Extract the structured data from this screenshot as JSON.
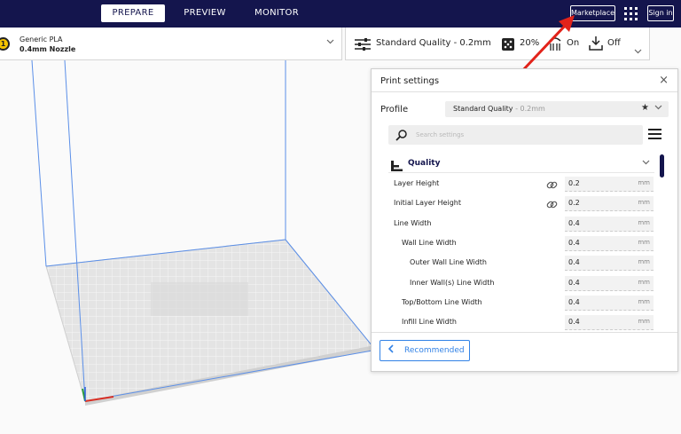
{
  "topbar": {
    "tabs": [
      {
        "label": "PREPARE",
        "active": true
      },
      {
        "label": "PREVIEW",
        "active": false
      },
      {
        "label": "MONITOR",
        "active": false
      }
    ],
    "marketplace_label": "Marketplace",
    "signin_label": "Sign in"
  },
  "printer": {
    "extruder_number": "1",
    "material": "Generic PLA",
    "nozzle": "0.4mm Nozzle"
  },
  "quality_bar": {
    "profile": "Standard Quality - 0.2mm",
    "infill": "20%",
    "support": "On",
    "adhesion": "Off"
  },
  "print_settings": {
    "title": "Print settings",
    "close_glyph": "×",
    "profile_label": "Profile",
    "profile_name": "Standard Quality",
    "profile_sub": " - 0.2mm",
    "search_placeholder": "Search settings",
    "category": "Quality",
    "rows": [
      {
        "label": "Layer Height",
        "value": "0.2",
        "unit": "mm",
        "linked": true,
        "indent": 0
      },
      {
        "label": "Initial Layer Height",
        "value": "0.2",
        "unit": "mm",
        "linked": true,
        "indent": 0
      },
      {
        "label": "Line Width",
        "value": "0.4",
        "unit": "mm",
        "linked": false,
        "indent": 0
      },
      {
        "label": "Wall Line Width",
        "value": "0.4",
        "unit": "mm",
        "linked": false,
        "indent": 1
      },
      {
        "label": "Outer Wall Line Width",
        "value": "0.4",
        "unit": "mm",
        "linked": false,
        "indent": 2
      },
      {
        "label": "Inner Wall(s) Line Width",
        "value": "0.4",
        "unit": "mm",
        "linked": false,
        "indent": 2
      },
      {
        "label": "Top/Bottom Line Width",
        "value": "0.4",
        "unit": "mm",
        "linked": false,
        "indent": 1
      },
      {
        "label": "Infill Line Width",
        "value": "0.4",
        "unit": "mm",
        "linked": false,
        "indent": 1
      }
    ],
    "recommended_label": "Recommended"
  },
  "colors": {
    "topbar": "#14154d",
    "accent": "#3282e6",
    "annotation_arrow": "#e2231a",
    "extruder": "#f5c400"
  }
}
